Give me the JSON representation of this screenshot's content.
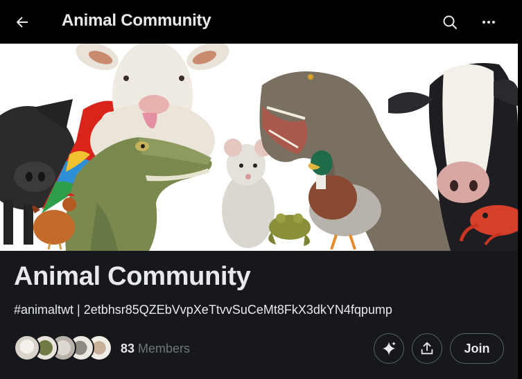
{
  "header": {
    "title": "Animal Community",
    "icons": {
      "back": "arrow-left-icon",
      "search": "search-icon",
      "more": "more-horizontal-icon"
    }
  },
  "banner": {
    "animals": [
      "pig",
      "parrot",
      "sheep",
      "alligator",
      "rooster",
      "rat",
      "frog",
      "t-rex",
      "duck",
      "cow",
      "crab"
    ]
  },
  "community": {
    "name": "Animal Community",
    "description": "#animaltwt | 2etbhsr85QZEbVvpXeTtvvSuCeMt8FkX3dkYN4fqpump",
    "member_count": "83",
    "members_label": " Members",
    "join_label": "Join"
  },
  "colors": {
    "background": "#000000",
    "panel": "#16181c",
    "text_primary": "#e7e9ea",
    "text_secondary": "#71767b",
    "border": "#536471"
  }
}
